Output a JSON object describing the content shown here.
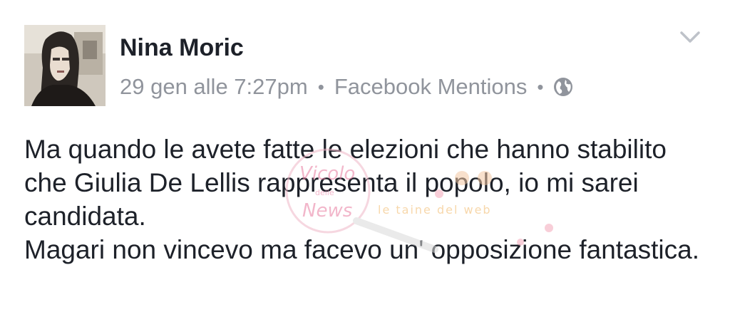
{
  "post": {
    "author": "Nina Moric",
    "timestamp": "29 gen alle 7:27pm",
    "separator": "•",
    "source": "Facebook Mentions",
    "privacy_icon": "globe-icon",
    "menu_icon": "chevron-down-icon",
    "paragraphs": [
      "Ma quando le avete fatte le elezioni che hanno stabilito che Giulia De Lellis rappresenta il popolo, io mi sarei candidata.",
      "Magari non vincevo ma facevo un' opposizione fantastica."
    ]
  },
  "watermark": {
    "line1": "Vicolo",
    "line2": "delle",
    "line3": "News",
    "tagline": "le taine del web"
  },
  "colors": {
    "name": "#1d2129",
    "meta": "#90949c",
    "watermark_pink": "#e87ca0"
  }
}
